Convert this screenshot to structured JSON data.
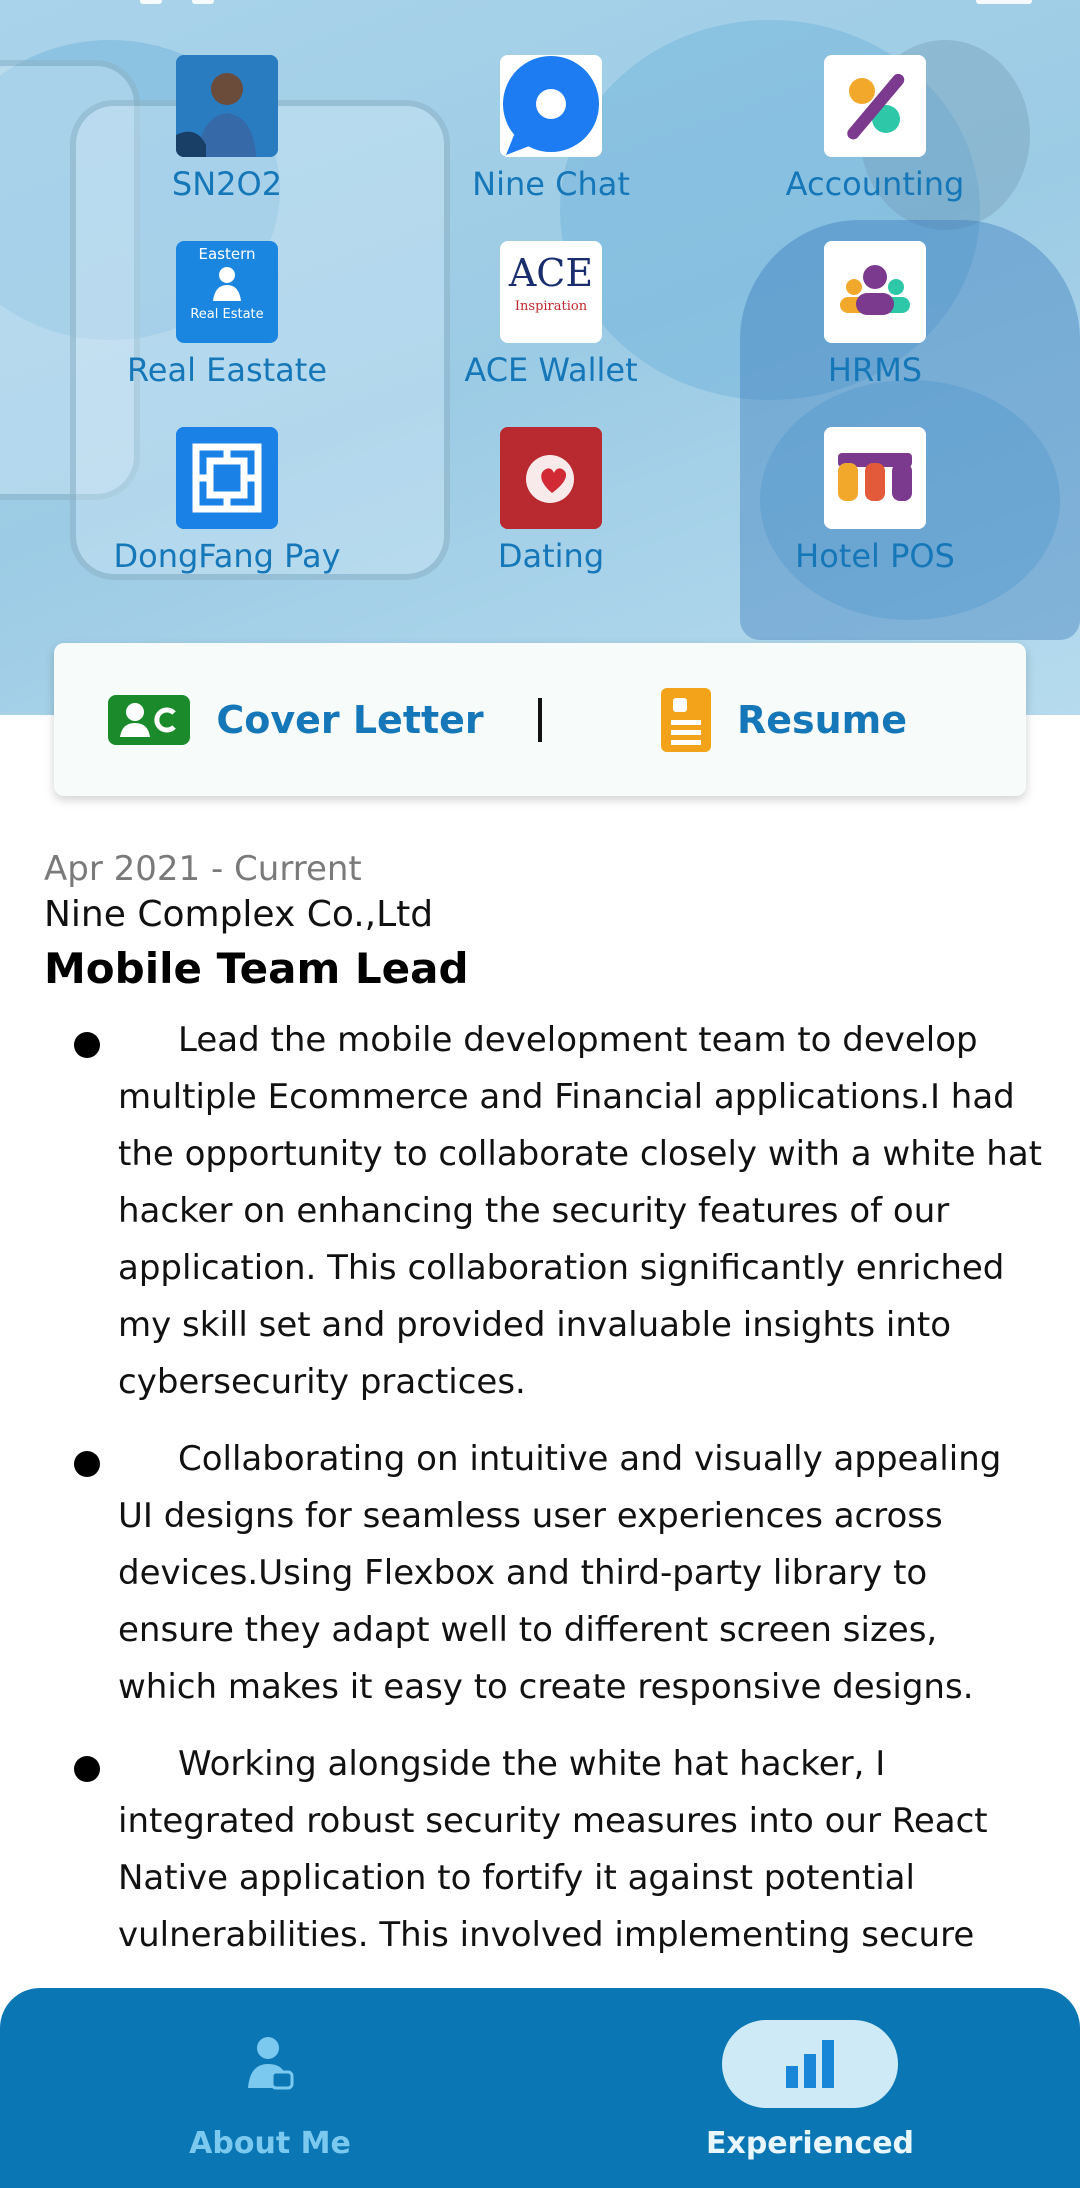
{
  "apps": [
    {
      "label": "SN2O2",
      "icon": "sn2o2-app-icon"
    },
    {
      "label": "Nine Chat",
      "icon": "nine-chat-app-icon"
    },
    {
      "label": "Accounting",
      "icon": "accounting-app-icon"
    },
    {
      "label": "Real Eastate",
      "icon": "real-estate-app-icon",
      "icon_title": "Eastern",
      "icon_subtitle": "Real Estate"
    },
    {
      "label": "ACE Wallet",
      "icon": "ace-wallet-app-icon",
      "icon_title": "ACE",
      "icon_subtitle": "Inspiration"
    },
    {
      "label": "HRMS",
      "icon": "hrms-app-icon"
    },
    {
      "label": "DongFang Pay",
      "icon": "dongfang-pay-app-icon"
    },
    {
      "label": "Dating",
      "icon": "dating-app-icon"
    },
    {
      "label": "Hotel POS",
      "icon": "hotel-pos-app-icon"
    }
  ],
  "segment": {
    "cover_letter": "Cover Letter",
    "resume": "Resume",
    "divider": "|"
  },
  "experience": {
    "period": "Apr 2021 - Current",
    "company": "Nine Complex Co.,Ltd",
    "role": "Mobile Team Lead",
    "bullets": [
      "Lead the mobile development team to develop multiple Ecommerce and Financial applications.I had the opportunity to collaborate closely with a white hat hacker on enhancing the security features of our application. This collaboration significantly enriched my skill set and provided invaluable insights into cybersecurity practices.",
      "Collaborating on intuitive and visually appealing UI designs for seamless user experiences across devices.Using Flexbox and third-party library to ensure they adapt well to different screen sizes, which makes it easy to create responsive designs.",
      "Working alongside the white hat hacker, I integrated robust security measures into our React Native application to fortify it against potential vulnerabilities. This involved implementing secure"
    ]
  },
  "nav": {
    "about_me": "About Me",
    "experienced": "Experienced",
    "active": "experienced"
  },
  "colors": {
    "accent": "#1577b8",
    "nav_bg": "#0a76b4",
    "nav_active_pill": "#cfeaf7",
    "cover_icon": "#1a8a2a",
    "resume_icon": "#f2a31a"
  }
}
